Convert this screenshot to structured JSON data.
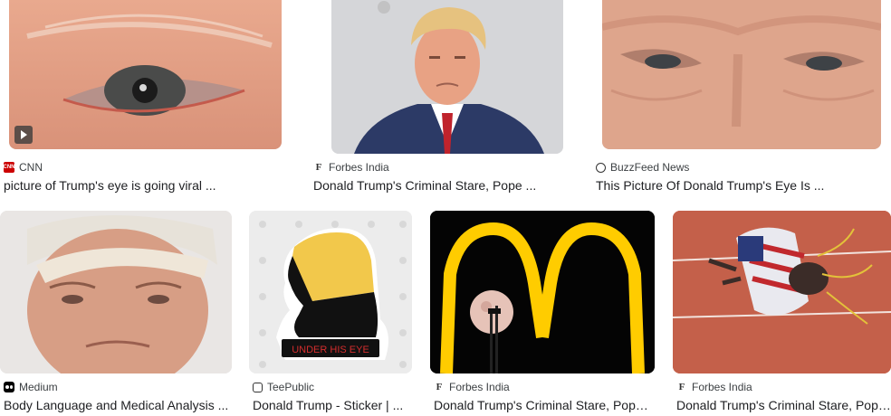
{
  "results": [
    {
      "source": "CNN",
      "title": "picture of Trump's eye is going viral ...",
      "favicon": "cnn-icon",
      "has_video": true
    },
    {
      "source": "Forbes India",
      "title": "Donald Trump's Criminal Stare, Pope ...",
      "favicon": "forbes-icon"
    },
    {
      "source": "BuzzFeed News",
      "title": "This Picture Of Donald Trump's Eye Is ...",
      "favicon": "buzzfeed-icon"
    },
    {
      "source": "Medium",
      "title": "Body Language and Medical Analysis ...",
      "favicon": "medium-icon"
    },
    {
      "source": "TeePublic",
      "title": "Donald Trump - Sticker | ...",
      "favicon": "teepublic-icon",
      "sticker_text": "UNDER HIS EYE"
    },
    {
      "source": "Forbes India",
      "title": "Donald Trump's Criminal Stare, Pope ...",
      "favicon": "forbes-icon"
    },
    {
      "source": "Forbes India",
      "title": "Donald Trump's Criminal Stare, Pope ...",
      "favicon": "forbes-icon"
    }
  ],
  "favicons": {
    "cnn": "CNN",
    "forbes": "F"
  },
  "colors": {
    "cnn_red": "#cc0000",
    "title": "#202124",
    "source": "#3c4043"
  }
}
